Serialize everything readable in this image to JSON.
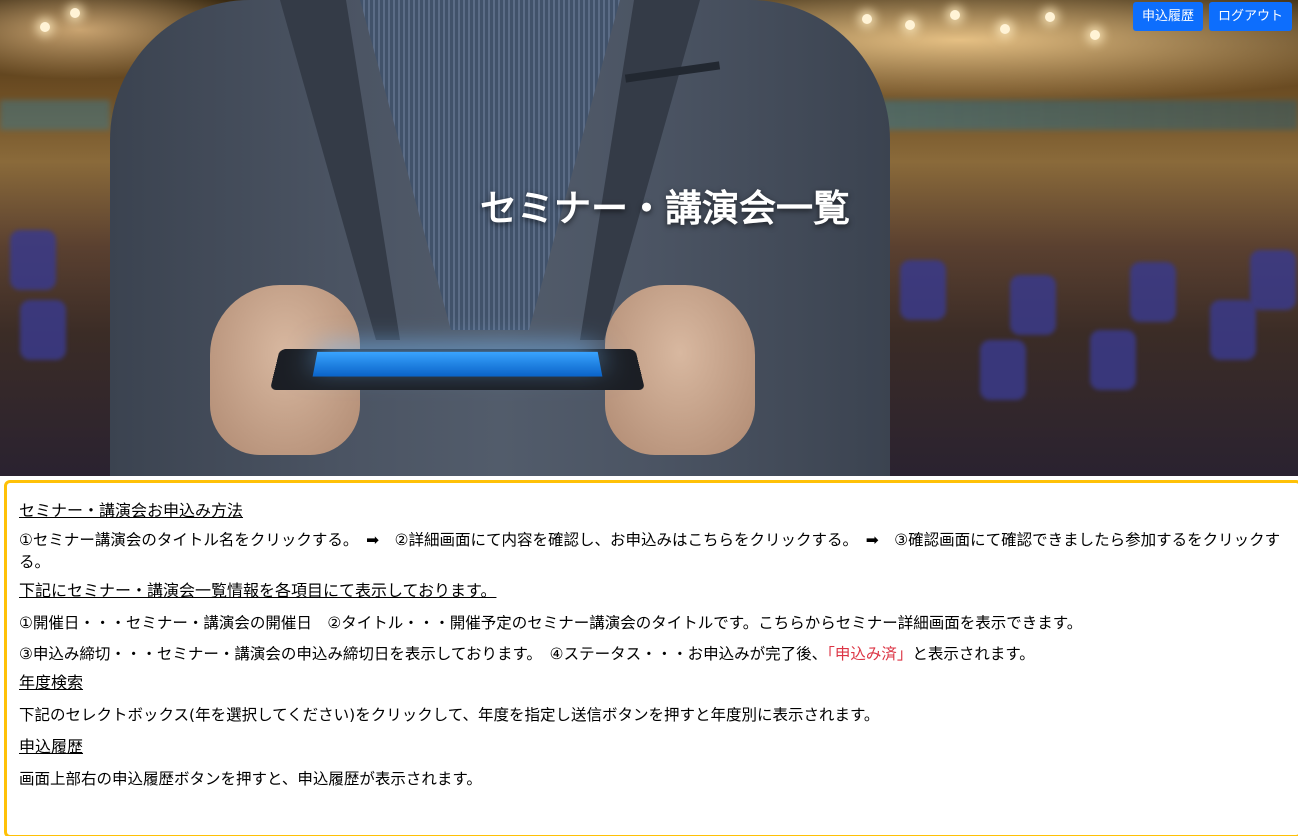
{
  "header": {
    "title": "セミナー・講演会一覧",
    "buttons": {
      "history": "申込履歴",
      "logout": "ログアウト"
    }
  },
  "info": {
    "howto_heading": "セミナー・講演会お申込み方法",
    "howto_steps": "①セミナー講演会のタイトル名をクリックする。　➡　②詳細画面にて内容を確認し、お申込みはこちらをクリックする。　➡　③確認画面にて確認できましたら参加するをクリックする。",
    "list_heading": "下記にセミナー・講演会一覧情報を各項目にて表示しております。",
    "list_line1": "①開催日・・・セミナー・講演会の開催日　②タイトル・・・開催予定のセミナー講演会のタイトルです。こちらからセミナー詳細画面を表示できます。",
    "list_line2_prefix": "③申込み締切・・・セミナー・講演会の申込み締切日を表示しております。　④ステータス・・・お申込みが完了後、",
    "list_line2_status": "「申込み済」",
    "list_line2_suffix": "と表示されます。",
    "year_heading": "年度検索",
    "year_text": "下記のセレクトボックス(年を選択してください)をクリックして、年度を指定し送信ボタンを押すと年度別に表示されます。",
    "history_heading": "申込履歴",
    "history_text": "画面上部右の申込履歴ボタンを押すと、申込履歴が表示されます。"
  },
  "colors": {
    "button": "#0d6efd",
    "info_border": "#ffc107",
    "status_highlight": "#dc3545"
  },
  "icons": {
    "hero": "businessman-holding-tablet-in-conference-hall-photo"
  }
}
